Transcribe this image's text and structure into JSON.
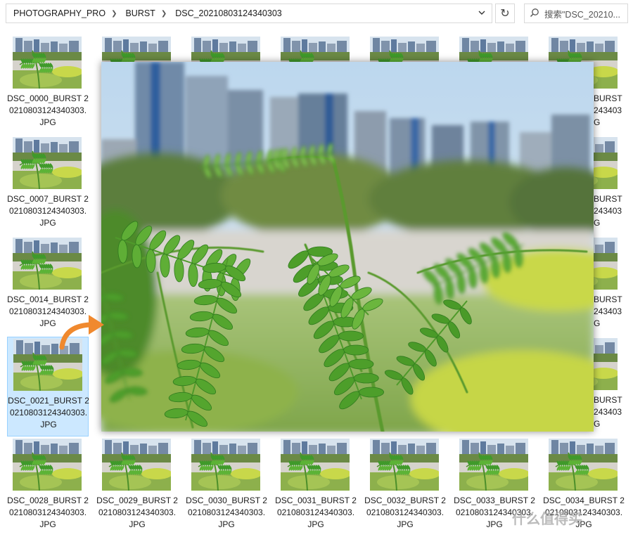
{
  "breadcrumb": [
    "PHOTOGRAPHY_PRO",
    "BURST",
    "DSC_20210803124340303"
  ],
  "search": {
    "placeholder": "搜索\"DSC_20210..."
  },
  "files": [
    {
      "name": "DSC_0000_BURST 20210803124340303.JPG",
      "selected": false
    },
    {
      "name": "DSC_0007_BURST 20210803124340303.JPG",
      "selected": false
    },
    {
      "name": "DSC_0014_BURST 20210803124340303.JPG",
      "selected": false
    },
    {
      "name": "DSC_0021_BURST 20210803124340303.JPG",
      "selected": true
    },
    {
      "name": "DSC_0028_BURST 20210803124340303.JPG",
      "selected": false
    },
    {
      "name": "DSC_0029_BURST 20210803124340303.JPG",
      "selected": false
    },
    {
      "name": "DSC_0030_BURST 20210803124340303.JPG",
      "selected": false
    },
    {
      "name": "DSC_0031_BURST 20210803124340303.JPG",
      "selected": false
    },
    {
      "name": "DSC_0032_BURST 20210803124340303.JPG",
      "selected": false
    },
    {
      "name": "DSC_0033_BURST 20210803124340303.JPG",
      "selected": false
    },
    {
      "name": "DSC_0034_BURST 20210803124340303.JPG",
      "selected": false
    }
  ],
  "partial_labels": [
    {
      "line1": "BURST",
      "line2": "243403",
      "line3": "G"
    },
    {
      "line1": "BURST",
      "line2": "243403",
      "line3": "G"
    },
    {
      "line1": "BURST",
      "line2": "243403",
      "line3": "G"
    },
    {
      "line1": "BURST",
      "line2": "243403",
      "line3": "G"
    }
  ],
  "watermark": "什么值得买",
  "icons": {
    "dropdown": "chevron-down-icon",
    "refresh": "refresh-icon",
    "search": "search-icon",
    "arrow": "curved-arrow-icon"
  },
  "colors": {
    "selection_bg": "#cce8ff",
    "selection_border": "#99d1ff",
    "arrow": "#f0892e"
  }
}
